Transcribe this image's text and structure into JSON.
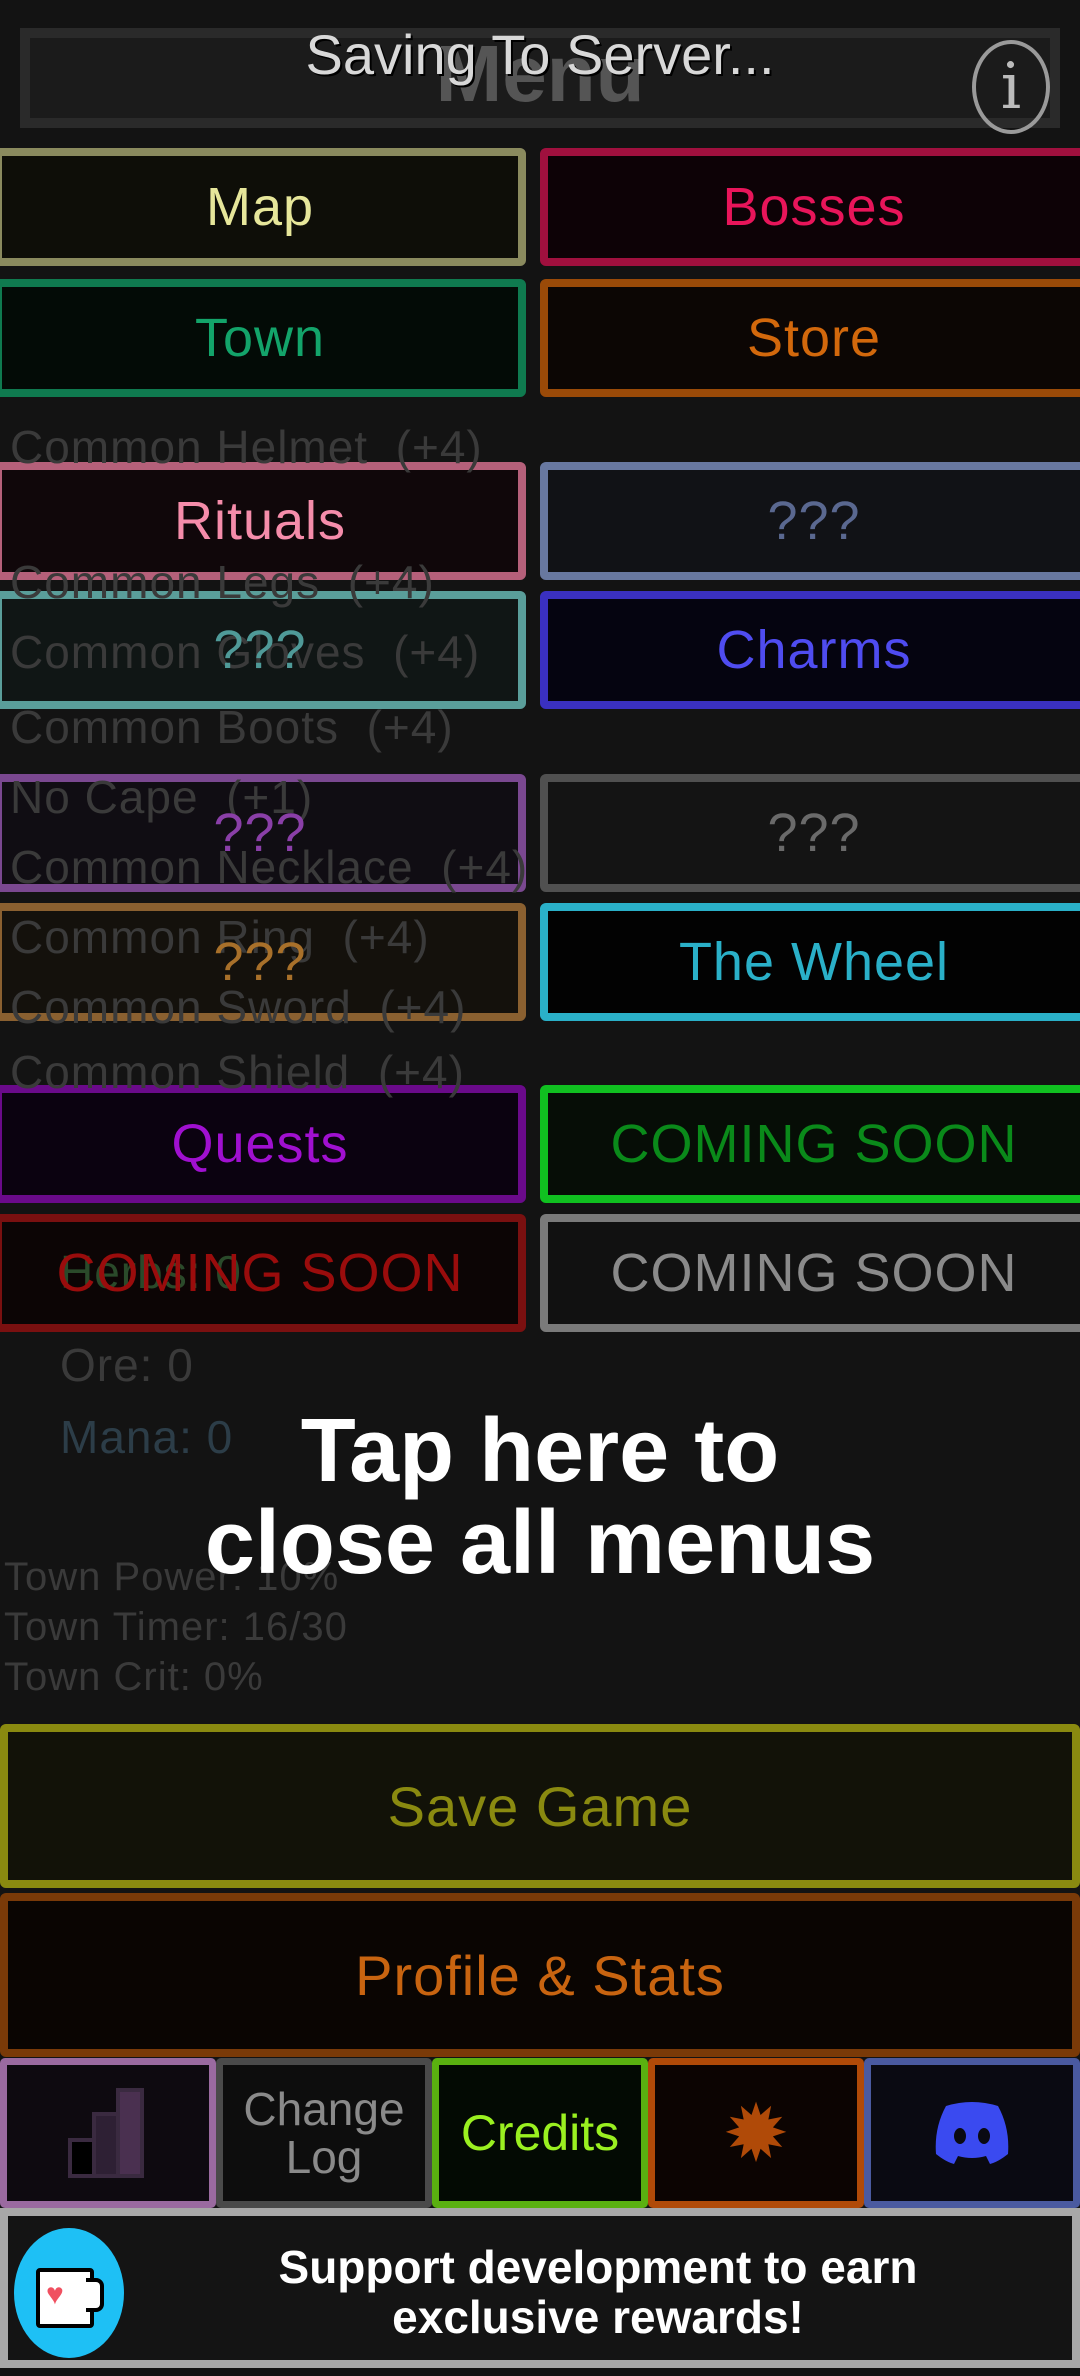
{
  "header": {
    "title": "Menu",
    "status": "Saving To Server...",
    "info_icon": "info-icon"
  },
  "background": {
    "equipment": [
      "Common Helmet  (+4)",
      "Common Legs  (+4)",
      "Common Gloves  (+4)",
      "Common Boots  (+4)",
      "No Cape  (+1)",
      "Common Necklace  (+4)",
      "Common Ring  (+4)",
      "Common Sword  (+4)",
      "Common Shield  (+4)"
    ],
    "resources": [
      "Herbs: 0",
      "Ore: 0",
      "Mana: 0"
    ],
    "town": [
      "Town Power: 10%",
      "Town Timer: 16/30",
      "Town Crit: 0%"
    ]
  },
  "menu": [
    {
      "label": "Map",
      "color": "#e6e69a",
      "border": "#8a8a5e",
      "bg": "#0e0e07"
    },
    {
      "label": "Bosses",
      "color": "#e8155a",
      "border": "#a0103e",
      "bg": "#0d0005"
    },
    {
      "label": "Town",
      "color": "#13a46a",
      "border": "#0f7a4f",
      "bg": "#010a05"
    },
    {
      "label": "Store",
      "color": "#d2680c",
      "border": "#9a4a08",
      "bg": "#0c0502"
    },
    {
      "label": "Rituals",
      "color": "#f58caa",
      "border": "#b5607a",
      "bg": "#100609"
    },
    {
      "label": "???",
      "color": "#5a6890",
      "border": "#6878a0",
      "bg": "#121318"
    },
    {
      "label": "???",
      "color": "#4f9a98",
      "border": "#5a9e9a",
      "bg": "#101716"
    },
    {
      "label": "Charms",
      "color": "#4f4cf0",
      "border": "#3a30c0",
      "bg": "#040210"
    },
    {
      "label": "???",
      "color": "#8a3fa8",
      "border": "#7a4890",
      "bg": "#110d14"
    },
    {
      "label": "???",
      "color": "#6a6a6a",
      "border": "#505050",
      "bg": "#151515"
    },
    {
      "label": "???",
      "color": "#a8702a",
      "border": "#8a6030",
      "bg": "#15120c"
    },
    {
      "label": "The Wheel",
      "color": "#2ab0c8",
      "border": "#2ab0c8",
      "bg": "#000000"
    },
    {
      "label": "Quests",
      "color": "#a010d0",
      "border": "#6a0a8a",
      "bg": "#0a0010"
    },
    {
      "label": "COMING SOON",
      "color": "#0a8a1a",
      "border": "#10c020",
      "bg": "#050d05"
    },
    {
      "label": "COMING SOON",
      "color": "#9a0c0c",
      "border": "#7a1010",
      "bg": "#0c0303"
    },
    {
      "label": "COMING SOON",
      "color": "#8a8a8a",
      "border": "#7a7a7a",
      "bg": "#121212"
    }
  ],
  "overlay_hint": [
    "Tap here to",
    "close all menus"
  ],
  "save_game": {
    "label": "Save Game",
    "color": "#8a8a10",
    "border": "#8a8a10"
  },
  "profile": {
    "label": "Profile & Stats",
    "color": "#c86410",
    "border": "#7a3a08"
  },
  "bottom_bar": {
    "leaderboard_icon": "leaderboard-bars-icon",
    "changelog_label": "Change\nLog",
    "credits_label": "Credits",
    "settings_icon": "gear-icon",
    "discord_icon": "discord-icon"
  },
  "support": {
    "text": "Support development to earn exclusive rewards!",
    "icon": "kofi-cup-heart-icon",
    "accent": "#1ec0f5"
  }
}
